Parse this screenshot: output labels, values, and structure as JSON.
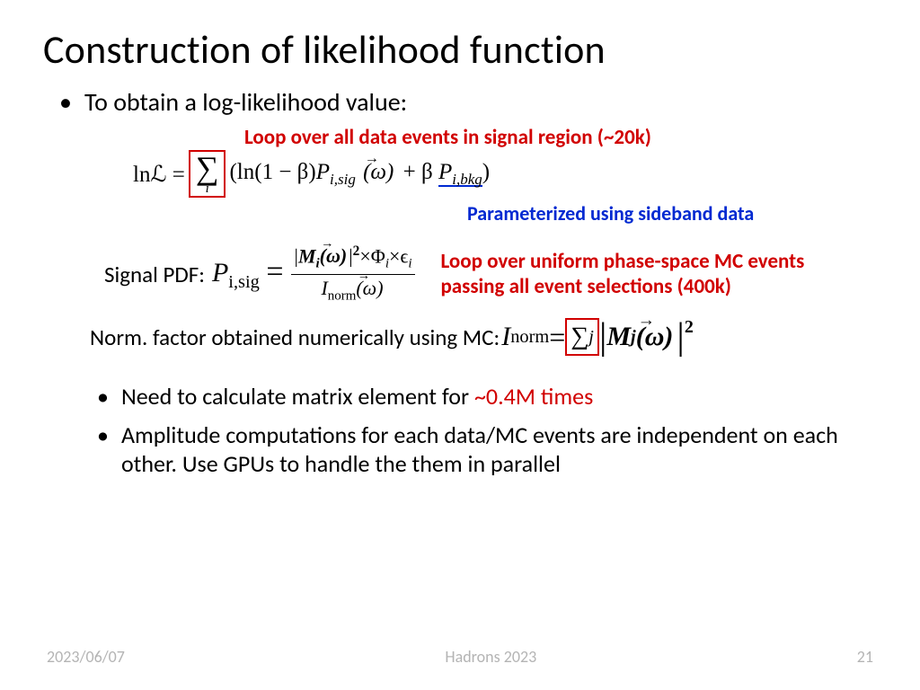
{
  "title": "Construction of likelihood function",
  "bullet1": "To obtain a log-likelihood value:",
  "eq1": {
    "lhs": "lnℒ =",
    "sum_index": "i",
    "body_a": "(ln(1 − β)",
    "Psig": "P",
    "Psig_sub": "i,sig",
    "omega": "(ω)",
    "plus": " + β ",
    "Pbkg": "P",
    "Pbkg_sub": "i,bkg",
    "close": ")"
  },
  "ann_loop_data": "Loop over all data events in signal region (~20k)",
  "ann_sideband": "Parameterized using sideband data",
  "sigpdf_label": "Signal PDF:",
  "sigpdf": {
    "P": "P",
    "Psub": "i,sig",
    "eq": " = ",
    "num_a": "|",
    "num_M": "M",
    "num_Msub": "i",
    "num_arg": "(ω)",
    "num_b": "|",
    "num_sq": "2",
    "num_times1": "×Φ",
    "num_phisub": "i",
    "num_times2": "×ϵ",
    "num_esub": "i",
    "den_I": "I",
    "den_Isub": "norm",
    "den_arg": "(ω)"
  },
  "ann_loop_mc_l1": "Loop over uniform phase-space MC events",
  "ann_loop_mc_l2": "passing all event selections (400k)",
  "norm_label": "Norm. factor obtained numerically using MC:",
  "norm_eq": {
    "I": "I",
    "Isub": "norm",
    "eq": " = ",
    "sumj": "j",
    "M": "M",
    "Msub": "j",
    "arg": "(ω)",
    "sq": "2"
  },
  "bullet2a_pre": "Need to calculate matrix element for ",
  "bullet2a_red": "~0.4M times",
  "bullet2b": "Amplitude computations for each data/MC events are independent on each other. Use GPUs to handle the them in parallel",
  "footer": {
    "date": "2023/06/07",
    "venue": "Hadrons 2023",
    "page": "21"
  }
}
